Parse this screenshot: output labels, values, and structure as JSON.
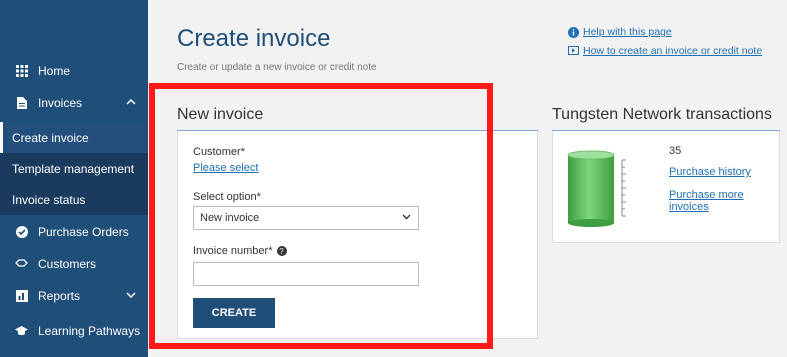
{
  "sidebar": {
    "items": [
      {
        "label": "Home"
      },
      {
        "label": "Invoices"
      },
      {
        "label": "Create invoice"
      },
      {
        "label": "Template management"
      },
      {
        "label": "Invoice status"
      },
      {
        "label": "Purchase Orders"
      },
      {
        "label": "Customers"
      },
      {
        "label": "Reports"
      },
      {
        "label": "Learning Pathways"
      }
    ]
  },
  "page": {
    "title": "Create invoice",
    "subtitle": "Create or update a new invoice or credit note"
  },
  "help": {
    "help_page": "Help with this page",
    "how_to": "How to create an invoice or credit note"
  },
  "form": {
    "section_title": "New invoice",
    "customer_label": "Customer*",
    "customer_link": "Please select",
    "option_label": "Select option*",
    "option_value": "New invoice",
    "invoice_number_label": "Invoice number*",
    "invoice_number_value": "",
    "create_button": "CREATE"
  },
  "tungsten": {
    "section_title": "Tungsten Network transactions",
    "count": "35",
    "purchase_history": "Purchase history",
    "purchase_more_line1": "Purchase more",
    "purchase_more_line2": "invoices",
    "gauge_color": "#5cb85c"
  },
  "colors": {
    "sidebar": "#1f4e79",
    "accent": "#1f4e79",
    "link": "#1f6fb2",
    "highlight": "#ff1a1a"
  }
}
